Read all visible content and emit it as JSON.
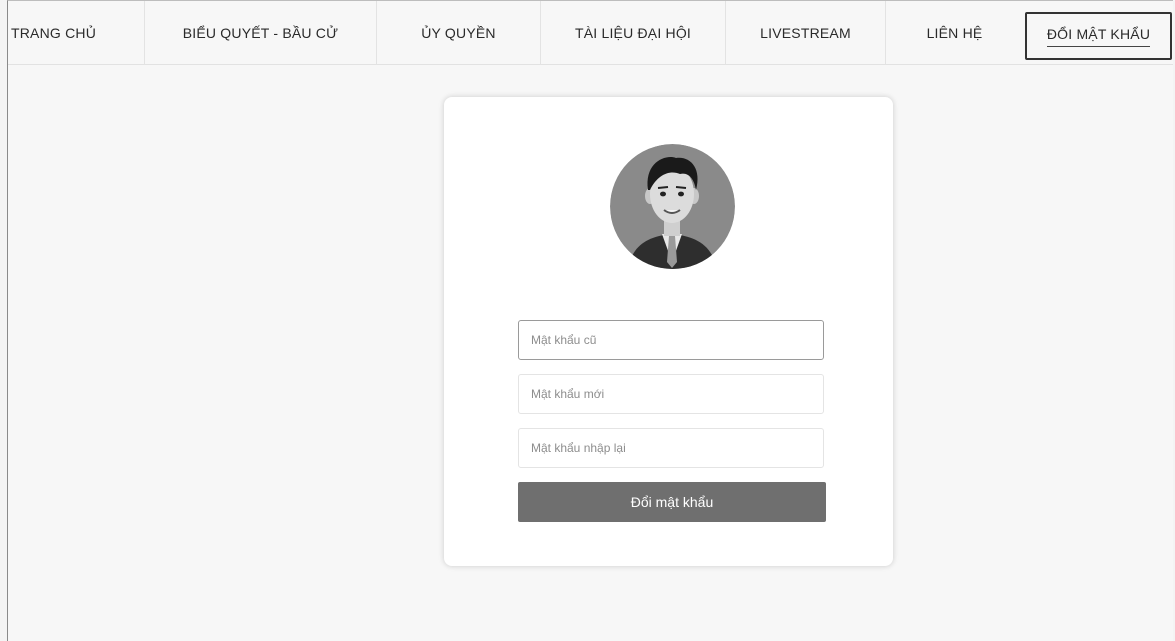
{
  "nav": {
    "items": [
      {
        "label": "TRANG CHỦ"
      },
      {
        "label": "BIỂU QUYẾT - BẦU CỬ"
      },
      {
        "label": "ỦY QUYỀN"
      },
      {
        "label": "TÀI LIỆU ĐẠI HỘI"
      },
      {
        "label": "LIVESTREAM"
      },
      {
        "label": "LIÊN HỆ"
      },
      {
        "label": "ĐỔI MẬT KHẨU"
      }
    ],
    "active_index": 6
  },
  "form": {
    "old_password_placeholder": "Mật khẩu cũ",
    "new_password_placeholder": "Mật khẩu mới",
    "confirm_password_placeholder": "Mật khẩu nhập lại",
    "submit_label": "Đổi mật khẩu",
    "avatar_icon": "user-avatar-icon"
  },
  "colors": {
    "button_bg": "#6f6f6f",
    "active_border": "#333333"
  }
}
